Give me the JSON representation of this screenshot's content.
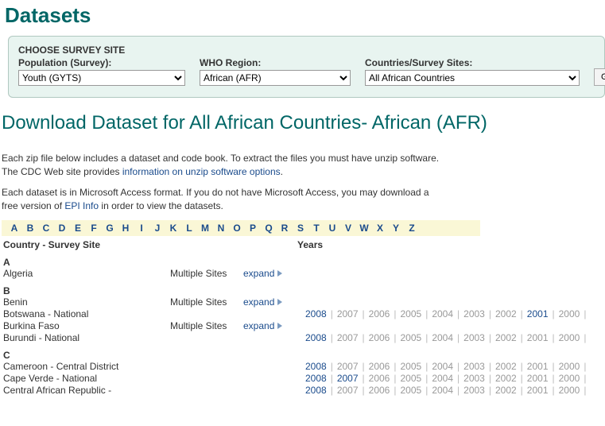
{
  "page_title": "Datasets",
  "filter": {
    "title": "CHOOSE SURVEY SITE",
    "population_label": "Population (Survey):",
    "population_value": "Youth (GYTS)",
    "region_label": "WHO Region:",
    "region_value": "African (AFR)",
    "country_label": "Countries/Survey Sites:",
    "country_value": "All African Countries",
    "go_label": "GO"
  },
  "section_title": "Download Dataset for All African Countries- African (AFR)",
  "intro": {
    "p1a": "Each zip file below includes a dataset and code book. To extract the files you must have unzip software. The CDC Web site provides ",
    "link1": "information on unzip software options",
    "p1b": ".",
    "p2a": "Each dataset is in Microsoft Access format. If you do not have Microsoft Access, you may download a free version of ",
    "link2": "EPI Info",
    "p2b": " in order to view the datasets."
  },
  "alphabet": [
    "A",
    "B",
    "C",
    "D",
    "E",
    "F",
    "G",
    "H",
    "I",
    "J",
    "K",
    "L",
    "M",
    "N",
    "O",
    "P",
    "Q",
    "R",
    "S",
    "T",
    "U",
    "V",
    "W",
    "X",
    "Y",
    "Z"
  ],
  "headers": {
    "country": "Country - Survey Site",
    "years": "Years"
  },
  "multiple_sites_label": "Multiple Sites",
  "expand_label": "expand",
  "year_list": [
    "2008",
    "2007",
    "2006",
    "2005",
    "2004",
    "2003",
    "2002",
    "2001",
    "2000"
  ],
  "groups": [
    {
      "letter": "A",
      "rows": [
        {
          "name": "Algeria",
          "multi": true
        }
      ]
    },
    {
      "letter": "B",
      "rows": [
        {
          "name": "Benin",
          "multi": true
        },
        {
          "name": "Botswana - National",
          "multi": false,
          "available": [
            "2008",
            "2001"
          ]
        },
        {
          "name": "Burkina Faso",
          "multi": true
        },
        {
          "name": "Burundi - National",
          "multi": false,
          "available": [
            "2008"
          ]
        }
      ]
    },
    {
      "letter": "C",
      "rows": [
        {
          "name": "Cameroon - Central District",
          "multi": false,
          "available": [
            "2008"
          ]
        },
        {
          "name": "Cape Verde - National",
          "multi": false,
          "available": [
            "2008",
            "2007"
          ]
        },
        {
          "name": "Central African Republic -",
          "multi": false,
          "available": [
            "2008"
          ]
        }
      ]
    }
  ]
}
